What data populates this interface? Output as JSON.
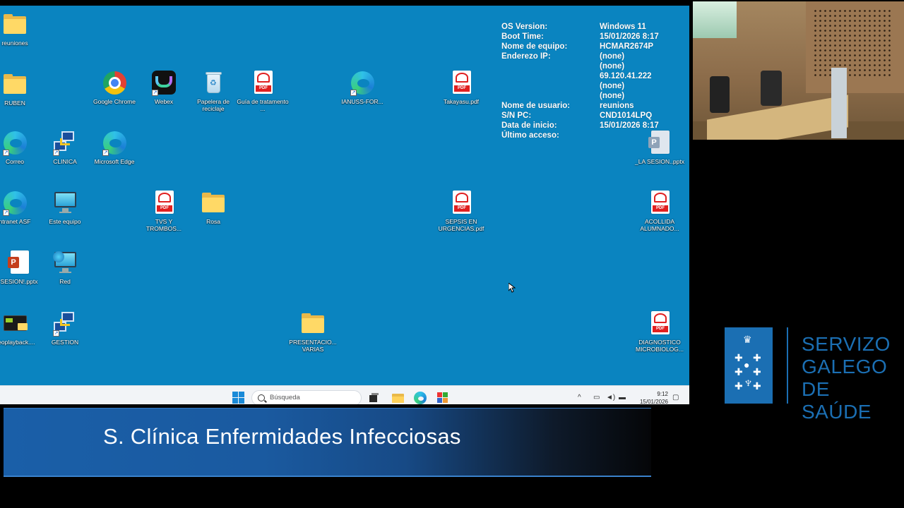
{
  "desktop": {
    "icons": [
      {
        "label": "reuniones"
      },
      {
        "label": "RUBEN"
      },
      {
        "label": "Google Chrome"
      },
      {
        "label": "Webex"
      },
      {
        "label": "Papelera de reciclaje"
      },
      {
        "label": "Guía de tratamento ..."
      },
      {
        "label": "IANUSS-FOR..."
      },
      {
        "label": "Takayasu.pdf"
      },
      {
        "label": "Correo"
      },
      {
        "label": "CLINICA"
      },
      {
        "label": "Microsoft Edge"
      },
      {
        "label": "_LA SESION..pptx"
      },
      {
        "label": "ntranet ASF"
      },
      {
        "label": "Este equipo"
      },
      {
        "label": "TVS Y TROMBOS..."
      },
      {
        "label": "Rosa"
      },
      {
        "label": "SEPSIS EN URGENCIAS.pdf"
      },
      {
        "label": "ACOLLIDA ALUMNADO..."
      },
      {
        "label": "SESION!.pptx"
      },
      {
        "label": "Red"
      },
      {
        "label": "deoplayback...."
      },
      {
        "label": "GESTION"
      },
      {
        "label": "PRESENTACIO... VARIAS"
      },
      {
        "label": "DIAGNOSTICO MICROBIOLOG..."
      }
    ],
    "pdf_tag": "PDF"
  },
  "sysinfo": {
    "rows": [
      {
        "k": "OS Version:",
        "v": "Windows 11"
      },
      {
        "k": "Boot Time:",
        "v": "15/01/2026 8:17"
      },
      {
        "k": "Nome de equipo:",
        "v": "HCMAR2674P"
      },
      {
        "k": "Enderezo IP:",
        "v": "(none)"
      },
      {
        "k": "",
        "v": "(none)"
      },
      {
        "k": "",
        "v": "69.120.41.222"
      },
      {
        "k": "",
        "v": "(none)"
      },
      {
        "k": "",
        "v": "(none)"
      },
      {
        "k": "Nome de usuario:",
        "v": "reunions"
      },
      {
        "k": "S/N PC:",
        "v": "CND1014LPQ"
      },
      {
        "k": "Data de inicio:",
        "v": "15/01/2026 8:17"
      },
      {
        "k": "Último acceso:",
        "v": ""
      }
    ]
  },
  "taskbar": {
    "search_placeholder": "Búsqueda",
    "time": "9:12",
    "date": "15/01/2026"
  },
  "logo": {
    "line1": "SERVIZO",
    "line2": "GALEGO",
    "line3": "DE SAÚDE"
  },
  "banner": {
    "title": "S. Clínica Enfermidades Infecciosas"
  },
  "colors": {
    "desktop_bg": "#0a84c0",
    "brand_blue": "#1b6fb3",
    "banner_blue": "#1a5fa8"
  }
}
